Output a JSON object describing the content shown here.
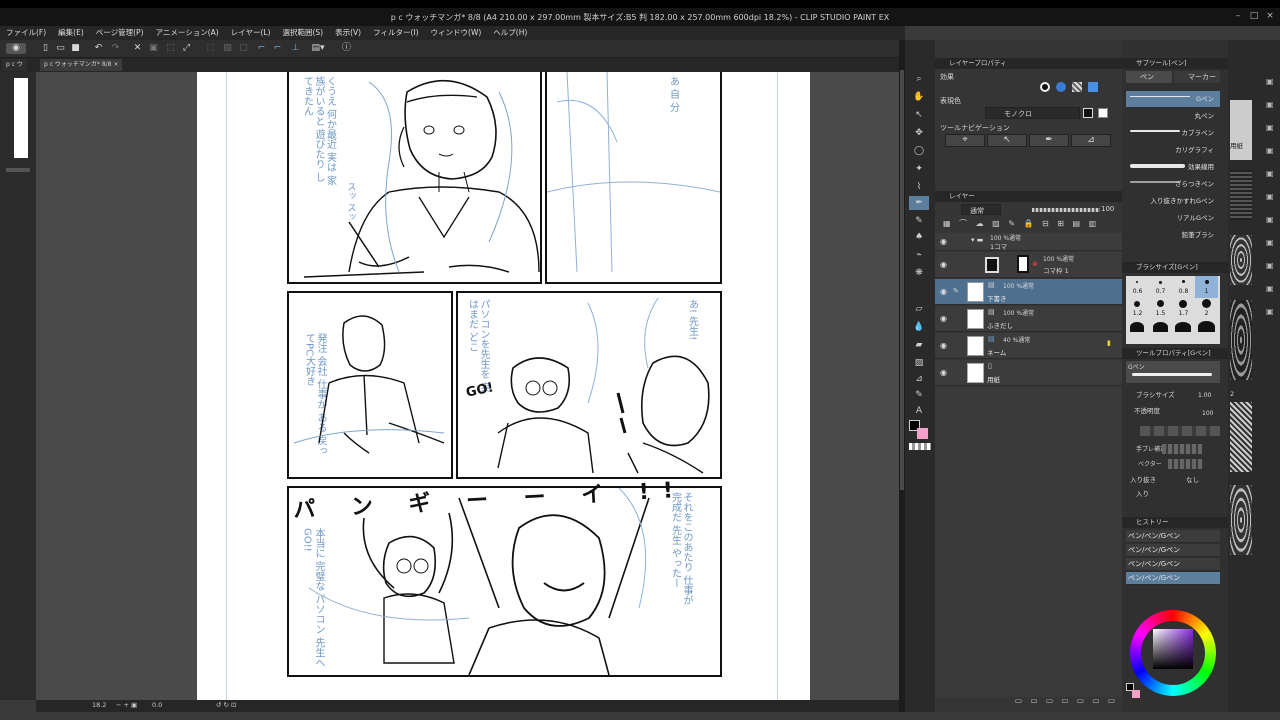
{
  "window": {
    "title": "p c ウォッチマンガ* 8/8 (A4 210.00 x 297.00mm 製本サイズ:B5 判 182.00 x 257.00mm 600dpi 18.2%) - CLIP STUDIO PAINT EX",
    "min_icon": "minimize-icon",
    "max_icon": "maximize-icon",
    "close_icon": "close-icon"
  },
  "menu": [
    "ファイル(F)",
    "編集(E)",
    "ページ管理(P)",
    "アニメーション(A)",
    "レイヤー(L)",
    "選択範囲(S)",
    "表示(V)",
    "フィルター(I)",
    "ウィンドウ(W)",
    "ヘルプ(H)"
  ],
  "doc_tabs": [
    "p c ウ",
    "p c ウォッチマンガ* 8/8"
  ],
  "status": {
    "zoom": "18.2",
    "angle": "0.0"
  },
  "manga": {
    "sfx_top": "パ ン ギ ー ー イ !!",
    "go": "GO!",
    "blue_p1": "くうえ 何か最近 実は 家族がいると 遊びたり  してきたん",
    "blue_p1b": "スッ スッ",
    "blue_p2": "あ 自 分",
    "blue_p3": "発注 会社 仕事が ある 戻ってPC大好き",
    "blue_p4": "パソコンを先生を 実はまだ どこ",
    "blue_p4b": "あ! 先生!",
    "blue_p5": "本当に 完璧な パソコン 先生へ GO!!",
    "blue_p5b": "それをこのあたり 仕事が 完成だ 先生 やったー"
  },
  "property_panel": {
    "effect_label": "効果",
    "expression_label": "表現色",
    "expression_value": "モノクロ",
    "tool_nav_label": "ツールナビゲーション",
    "tab_label": "レイヤープロパティ"
  },
  "layer_panel": {
    "tab_label": "レイヤー",
    "blend": "通常",
    "opacity": "100",
    "layers": [
      {
        "mode": "100 %通常",
        "name": "1コマ"
      },
      {
        "mode": "100 %通常",
        "name": "コマ枠 1"
      },
      {
        "mode": "100 %通常",
        "name": "下書き"
      },
      {
        "mode": "100 %通常",
        "name": "ふきだし"
      },
      {
        "mode": "40 %通常",
        "name": "ネーム"
      },
      {
        "mode": "",
        "name": "用紙"
      }
    ]
  },
  "sub_tool": {
    "tab_label": "サブツール[ペン]",
    "tabs": [
      "ペン",
      "マーカー"
    ],
    "items": [
      "Gペン",
      "丸ペン",
      "カブラペン",
      "カリグラフィ",
      "効果線用",
      "ざらつきペン",
      "入り抜きかすれGペン",
      "リアルGペン",
      "鉛筆ブラシ"
    ]
  },
  "brush_size": {
    "tab_label": "ブラシサイズ[Gペン]",
    "values": [
      "0.6",
      "0.7",
      "0.8",
      "1",
      "1.2",
      "1.5",
      "1.7",
      "2",
      "2.5",
      "3",
      "4",
      "5"
    ]
  },
  "tool_property": {
    "tab_label": "ツールプロパティ[Gペン]",
    "tool_name": "Gペン",
    "size_label": "ブラシサイズ",
    "size_value": "1.00",
    "opacity_label": "不透明度",
    "opacity_value": "100",
    "stabilize_label": "手ブレ補正",
    "vector_label": "ベクター",
    "inout_label": "入り抜き",
    "inout_value": "なし",
    "in_label": "入り"
  },
  "history": {
    "tab_label": "ヒストリー",
    "items": [
      "ペン/ペン/Gペン",
      "ペン/ペン/Gペン",
      "ペン/ペン/Gペン",
      "ペン/ペン/Gペン"
    ]
  },
  "far_right": {
    "paper_label": "用紙",
    "num_label": "2"
  },
  "colors": {
    "main": "#000000",
    "sub": "#f5a0c8",
    "accent": "#5d7f9e"
  }
}
